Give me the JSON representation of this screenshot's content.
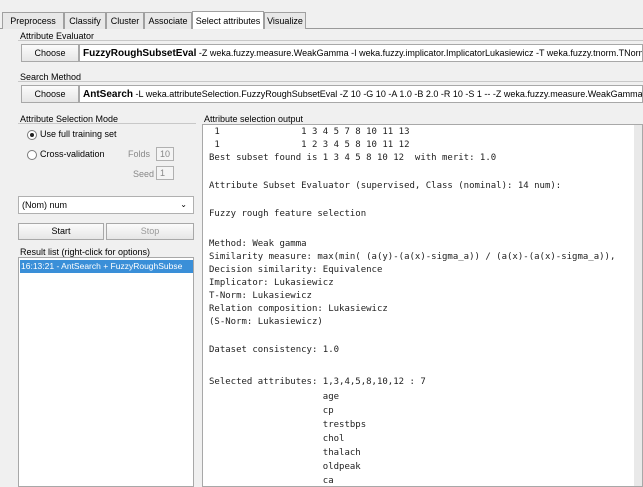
{
  "tabs": [
    {
      "label": "Preprocess"
    },
    {
      "label": "Classify"
    },
    {
      "label": "Cluster"
    },
    {
      "label": "Associate"
    },
    {
      "label": "Select attributes"
    },
    {
      "label": "Visualize"
    }
  ],
  "evaluator": {
    "group_label": "Attribute Evaluator",
    "choose_label": "Choose",
    "name": "FuzzyRoughSubsetEval",
    "options": "-Z weka.fuzzy.measure.WeakGamma -I weka.fuzzy.implicator.ImplicatorLukasiewicz -T weka.fuzzy.tnorm.TNormL"
  },
  "search": {
    "group_label": "Search Method",
    "choose_label": "Choose",
    "name": "AntSearch",
    "options": "-L weka.attributeSelection.FuzzyRoughSubsetEval -Z 10 -G 10 -A 1.0 -B 2.0 -R 10 -S 1 -- -Z weka.fuzzy.measure.WeakGamma -I"
  },
  "mode": {
    "group_label": "Attribute Selection Mode",
    "use_training": "Use full training set",
    "cross_validation": "Cross-validation",
    "folds_label": "Folds",
    "folds_value": "10",
    "seed_label": "Seed",
    "seed_value": "1"
  },
  "class_select": {
    "value": "(Nom) num"
  },
  "controls": {
    "start": "Start",
    "stop": "Stop"
  },
  "results": {
    "label": "Result list (right-click for options)",
    "items": [
      "16:13:21 - AntSearch + FuzzyRoughSubse"
    ]
  },
  "output": {
    "label": "Attribute selection output",
    "lines": [
      " 1               1 3 4 5 7 8 10 11 13",
      " 1               1 2 3 4 5 8 10 11 12",
      "Best subset found is 1 3 4 5 8 10 12  with merit: 1.0",
      "",
      "Attribute Subset Evaluator (supervised, Class (nominal): 14 num):",
      "",
      "Fuzzy rough feature selection",
      "",
      "Method: Weak gamma",
      "Similarity measure: max(min( (a(y)-(a(x)-sigma_a)) / (a(x)-(a(x)-sigma_a)),",
      "Decision similarity: Equivalence",
      "Implicator: Lukasiewicz",
      "T-Norm: Lukasiewicz",
      "Relation composition: Lukasiewicz",
      "(S-Norm: Lukasiewicz)",
      "",
      "Dataset consistency: 1.0",
      "",
      "Selected attributes: 1,3,4,5,8,10,12 : 7",
      "                     age",
      "                     cp",
      "                     trestbps",
      "                     chol",
      "                     thalach",
      "                     oldpeak",
      "                     ca"
    ]
  }
}
